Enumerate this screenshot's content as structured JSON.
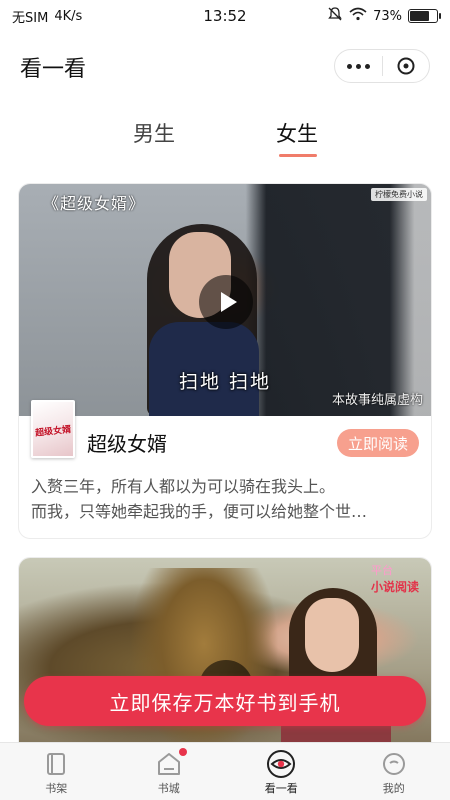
{
  "status_bar": {
    "carrier": "无SIM",
    "speed": "4K/s",
    "time": "13:52",
    "battery": "73%",
    "battery_level": 0.73
  },
  "header": {
    "title": "看一看"
  },
  "tabs": {
    "items": [
      "男生",
      "女生"
    ],
    "active": "女生"
  },
  "feed": {
    "cards": [
      {
        "video_title": "《超级女婿》",
        "video_badge": "柠檬免费小说",
        "video_subtitle": "扫地 扫地",
        "video_watermark": "本故事纯属虚构",
        "cover_text": "超级女婿",
        "book_name": "超级女婿",
        "read_label": "立即阅读",
        "desc_line1": "入赘三年，所有人都以为可以骑在我头上。",
        "desc_line2": "而我，只等她牵起我的手，便可以给她整个世…"
      },
      {
        "video_label_top": "平台",
        "video_label": "小说阅读"
      }
    ]
  },
  "cta": {
    "label": "立即保存万本好书到手机"
  },
  "tabbar": {
    "items": [
      {
        "label": "书架",
        "icon": "bookshelf-icon"
      },
      {
        "label": "书城",
        "icon": "bookstore-icon",
        "badge": true
      },
      {
        "label": "看一看",
        "icon": "watch-icon",
        "active": true
      },
      {
        "label": "我的",
        "icon": "profile-icon"
      }
    ]
  },
  "colors": {
    "accent_red": "#e8344b",
    "read_button": "#f7a08e",
    "tab_underline": "#f07c6a"
  }
}
